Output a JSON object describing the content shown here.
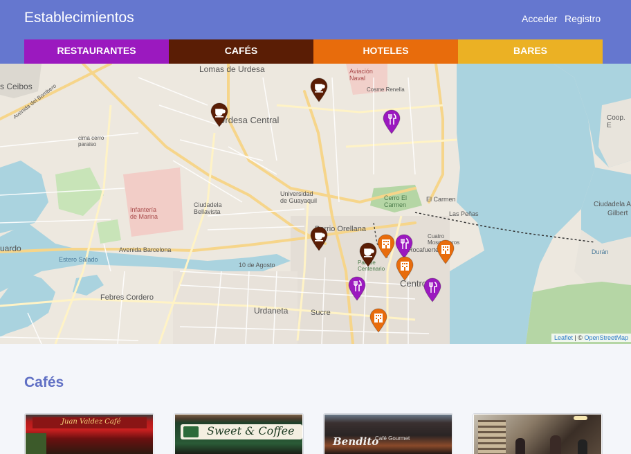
{
  "header": {
    "title": "Establecimientos",
    "login_label": "Acceder",
    "register_label": "Registro"
  },
  "categories": [
    {
      "label": "RESTAURANTES",
      "color": "#9b19bf"
    },
    {
      "label": "CAFÉS",
      "color": "#5a1d05"
    },
    {
      "label": "HOTELES",
      "color": "#e86c0c"
    },
    {
      "label": "BARES",
      "color": "#ebb124"
    }
  ],
  "map": {
    "labels": {
      "lomas": "Lomas de Urdesa",
      "ceibos": "s Ceibos",
      "urdesa": "Urdesa Central",
      "aviacion": "Aviación Naval",
      "renella": "Cosme Renella",
      "universidad": "Universidad de Guayaquil",
      "infanteria": "Infantería de Marina",
      "bellavista": "Ciudadela Bellavista",
      "orellana": "Barrio Orellana",
      "cerro": "Cerro El Carmen",
      "carmen": "El Carmen",
      "penas": "Las Peñas",
      "barcelona": "Avenida Barcelona",
      "agosto": "10 de Agosto",
      "febres": "Febres Cordero",
      "urdaneta": "Urdaneta",
      "sucre": "Sucre",
      "centro": "Centro",
      "ciudadela_alta": "Ciudadela A",
      "gilbert": "Gilbert",
      "duran": "Durán",
      "coop": "Coop. E",
      "uardo": "uardo",
      "estero": "Estero Salado",
      "bombero": "Avenida del Bombero",
      "cima": "cima cerro paraiso",
      "cuatro": "Cuatro Mosqueteros",
      "rocafuerte": "Rocafuerte",
      "centenario": "Parque Centenario"
    },
    "attribution": {
      "leaflet": "Leaflet",
      "sep": " | © ",
      "osm": "OpenStreetMap"
    },
    "markers": [
      {
        "type": "cafe",
        "icon": "coffee-cup-icon"
      },
      {
        "type": "cafe",
        "icon": "coffee-cup-icon"
      },
      {
        "type": "restaurant",
        "icon": "fork-knife-icon"
      },
      {
        "type": "cafe",
        "icon": "coffee-cup-icon"
      },
      {
        "type": "hotel",
        "icon": "building-icon"
      },
      {
        "type": "restaurant",
        "icon": "fork-knife-icon"
      },
      {
        "type": "cafe",
        "icon": "coffee-cup-icon"
      },
      {
        "type": "hotel",
        "icon": "building-icon"
      },
      {
        "type": "hotel",
        "icon": "building-icon"
      },
      {
        "type": "restaurant",
        "icon": "fork-knife-icon"
      },
      {
        "type": "restaurant",
        "icon": "fork-knife-icon"
      },
      {
        "type": "hotel",
        "icon": "building-icon"
      }
    ]
  },
  "section": {
    "title": "Cafés",
    "cards": [
      {
        "sign": "Juan Valdez Café"
      },
      {
        "sign": "Sweet & Coffee"
      },
      {
        "sign": "Bendito",
        "sub": "Café Gourmet"
      },
      {
        "sign": ""
      }
    ]
  }
}
